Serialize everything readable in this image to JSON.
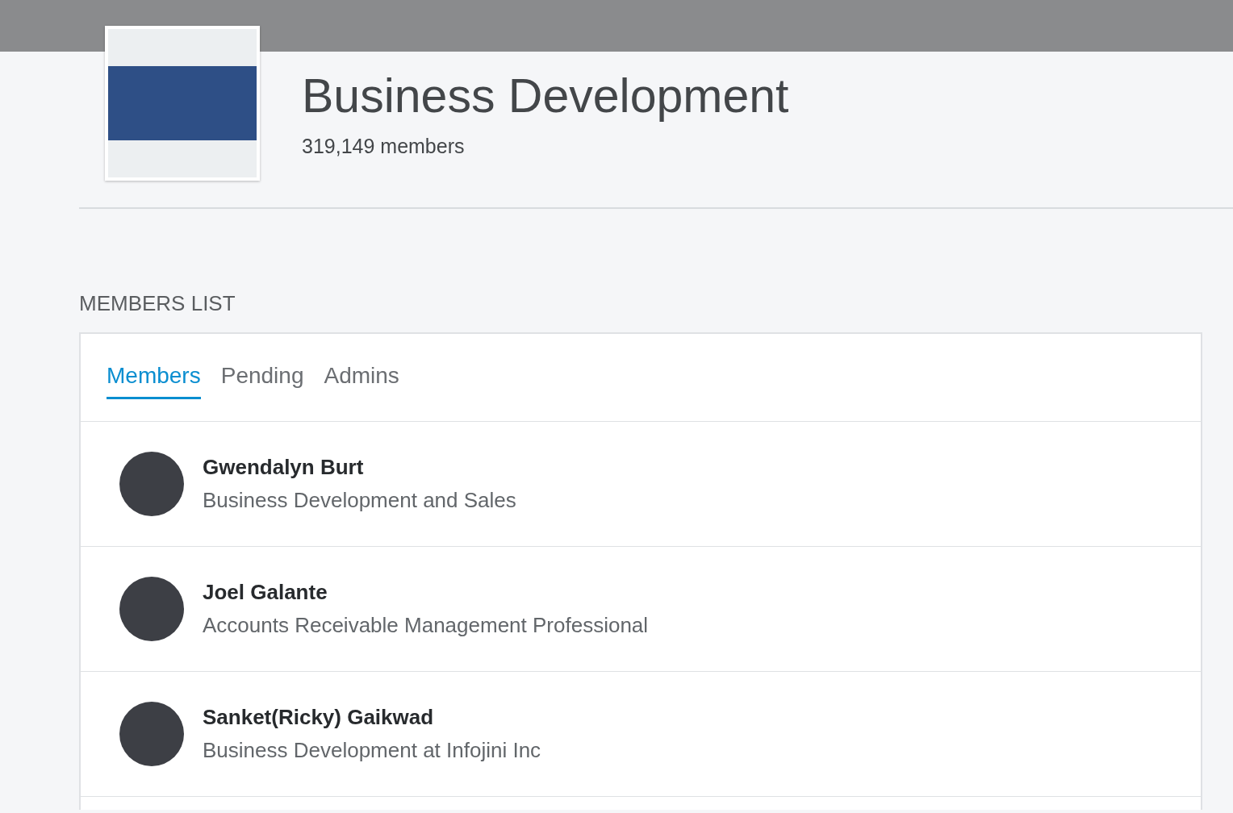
{
  "group": {
    "name": "Business Development",
    "member_count": "319,149 members"
  },
  "section_title": "MEMBERS LIST",
  "tabs": [
    {
      "label": "Members",
      "selected": true
    },
    {
      "label": "Pending",
      "selected": false
    },
    {
      "label": "Admins",
      "selected": false
    }
  ],
  "members": [
    {
      "name": "Gwendalyn Burt",
      "headline": "Business Development and Sales"
    },
    {
      "name": "Joel Galante",
      "headline": "Accounts Receivable Management Professional"
    },
    {
      "name": "Sanket(Ricky) Gaikwad",
      "headline": "Business Development at Infojini Inc"
    }
  ]
}
